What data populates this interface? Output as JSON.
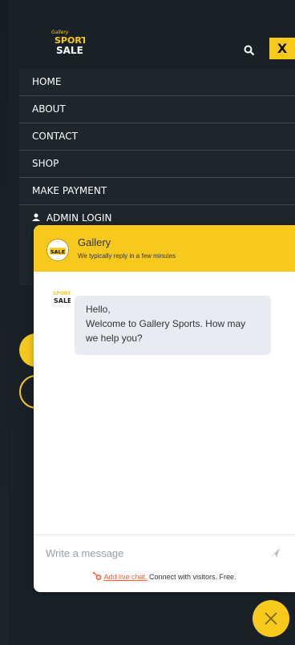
{
  "header": {
    "logo_text_top": "SPORTS",
    "logo_text_bottom": "SALE",
    "close_label": "X"
  },
  "nav": {
    "items": [
      {
        "label": "HOME"
      },
      {
        "label": "ABOUT"
      },
      {
        "label": "CONTACT"
      },
      {
        "label": "SHOP"
      },
      {
        "label": "MAKE PAYMENT"
      },
      {
        "label": "ADMIN LOGIN"
      }
    ]
  },
  "chat": {
    "title": "Gallery",
    "subtitle": "We typically reply in a few minutes",
    "message": {
      "line1": "Hello,",
      "line2": "Welcome to Gallery Sports. How may",
      "line3": "we help you?"
    },
    "composer_placeholder": "Write a message",
    "footer_link": "Add live chat.",
    "footer_text": " Connect with visitors. Free."
  },
  "colors": {
    "accent": "#f7c91d",
    "background": "#1a2126"
  },
  "icons": [
    "search-icon",
    "user-icon",
    "send-icon",
    "hubspot-icon",
    "close-icon"
  ]
}
